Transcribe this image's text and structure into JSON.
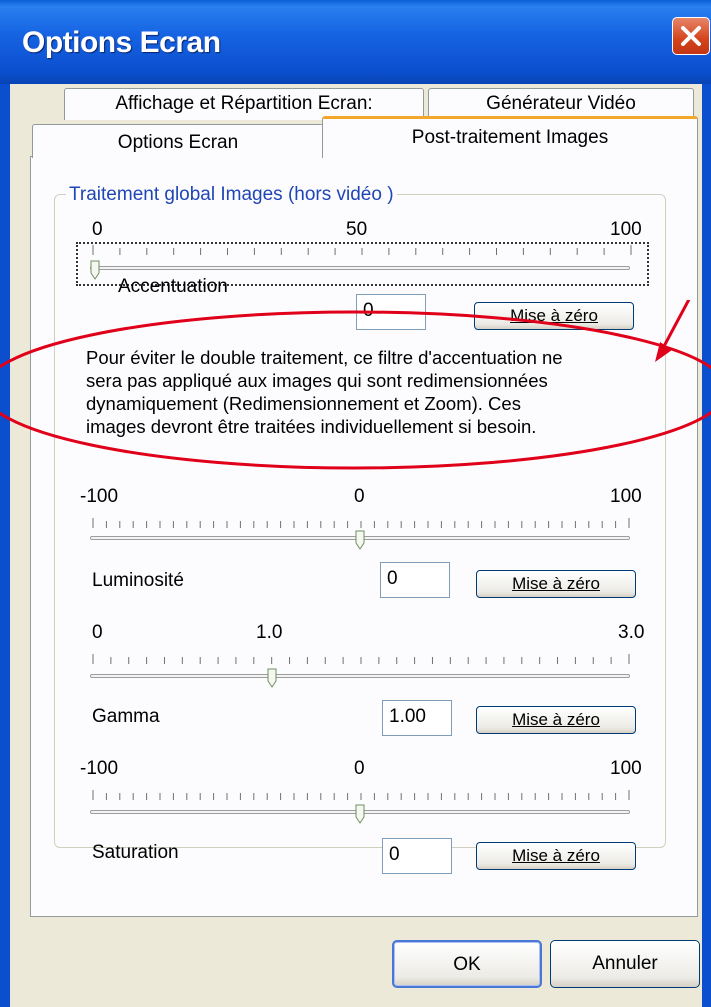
{
  "window": {
    "title": "Options Ecran"
  },
  "tabs": {
    "back_row": [
      "Affichage et Répartition Ecran:",
      "Générateur Vidéo"
    ],
    "front_row": [
      "Options Ecran",
      "Post-traitement Images"
    ],
    "active": "Post-traitement Images"
  },
  "group": {
    "title": "Traitement global Images (hors vidéo )"
  },
  "sliders": [
    {
      "name": "Accentuation",
      "labels": [
        "0",
        "50",
        "100"
      ],
      "min": 0,
      "max": 100,
      "value": 0,
      "input_value": "0",
      "reset_label": "Mise à zéro"
    },
    {
      "name": "Luminosité",
      "labels": [
        "-100",
        "0",
        "100"
      ],
      "min": -100,
      "max": 100,
      "value": 0,
      "input_value": "0",
      "reset_label": "Mise à zéro"
    },
    {
      "name": "Gamma",
      "labels": [
        "0",
        "1.0",
        "3.0"
      ],
      "min": 0,
      "max": 3,
      "value": 1.0,
      "input_value": "1.00",
      "reset_label": "Mise à zéro"
    },
    {
      "name": "Saturation",
      "labels": [
        "-100",
        "0",
        "100"
      ],
      "min": -100,
      "max": 100,
      "value": 0,
      "input_value": "0",
      "reset_label": "Mise à zéro"
    }
  ],
  "note": {
    "lines": [
      "Pour éviter le double traitement, ce filtre d'accentuation ne",
      "sera pas appliqué aux images qui sont redimensionnées",
      "dynamiquement (Redimensionnement et Zoom). Ces",
      "images devront être traitées individuellement si besoin."
    ]
  },
  "footer": {
    "ok_label": "OK",
    "cancel_label": "Annuler"
  },
  "colors": {
    "titlebar": "#0b4fcf",
    "annotation": "#e0001a",
    "group_title": "#1f46b5"
  }
}
